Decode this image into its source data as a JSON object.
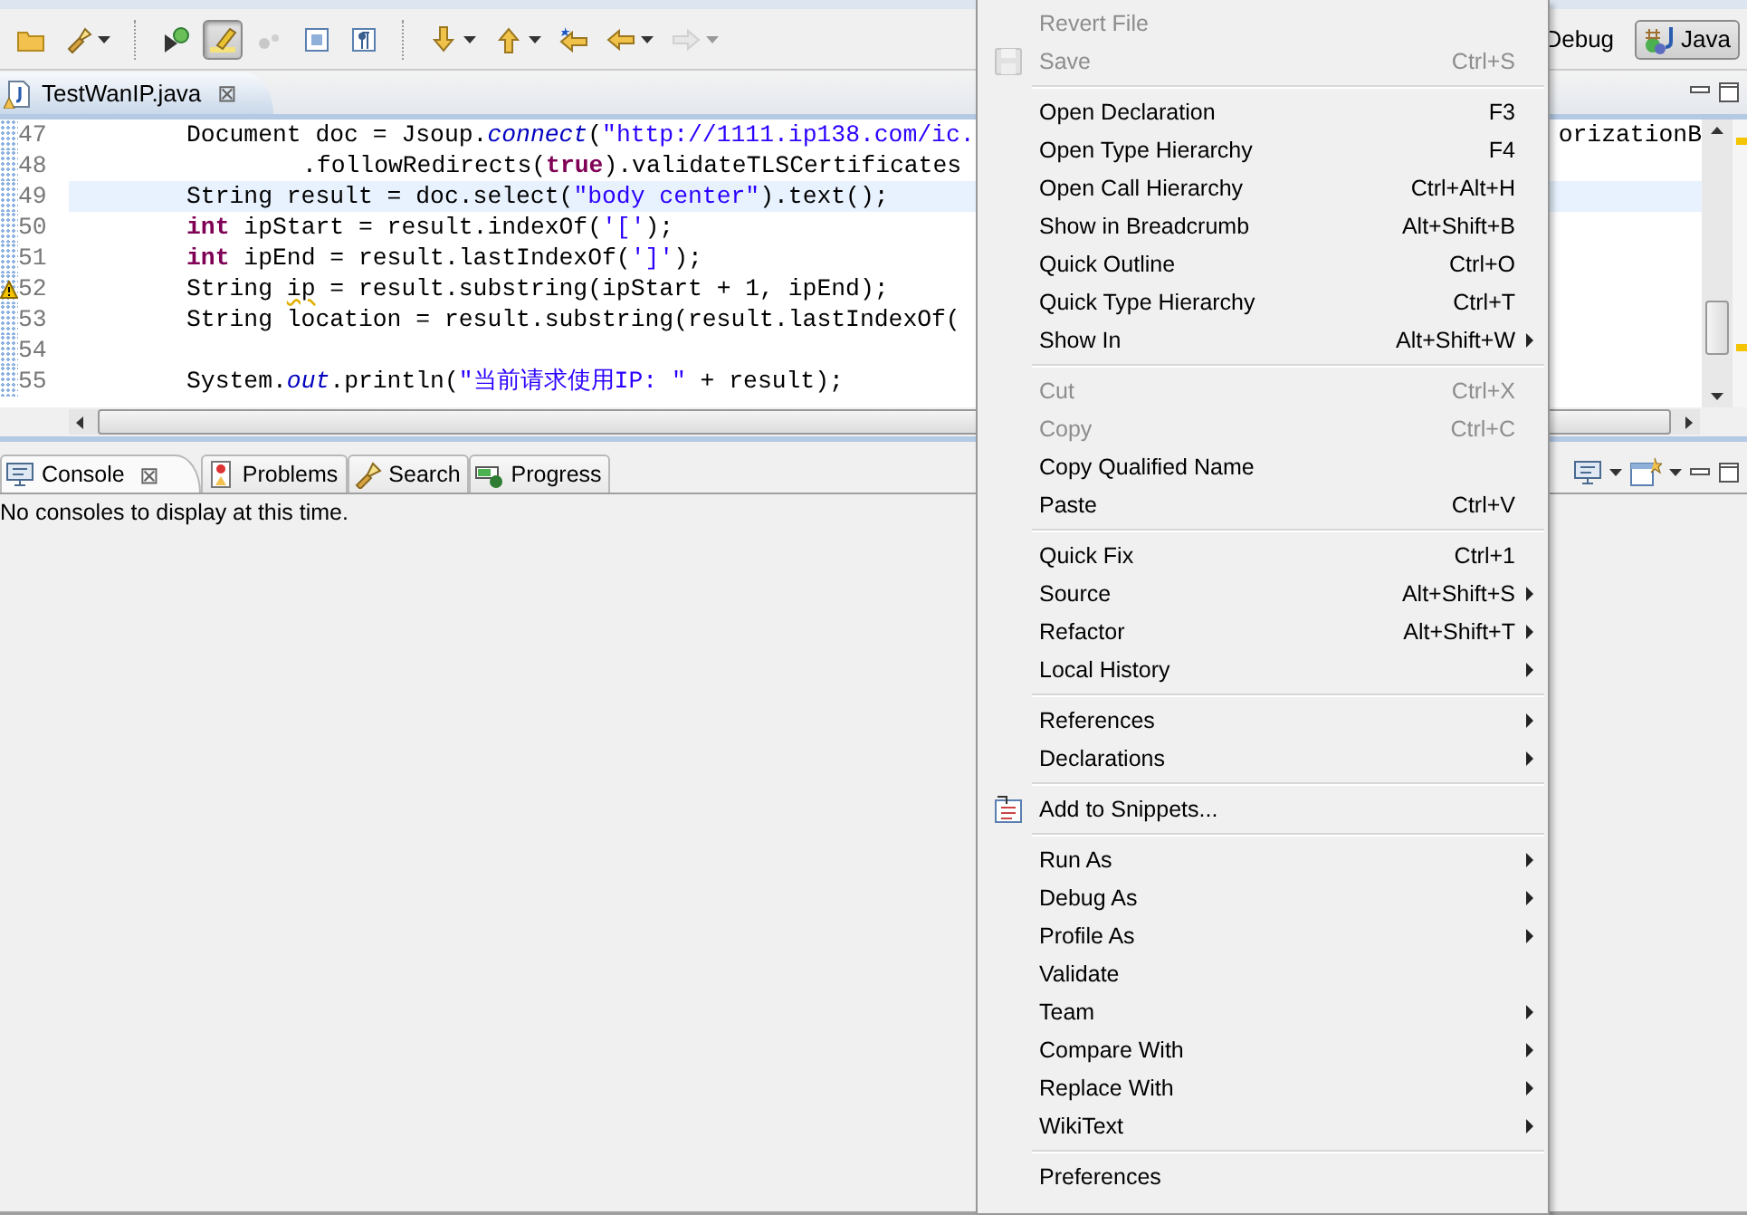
{
  "toolbar": {
    "items": [
      {
        "kind": "tool",
        "pressed": false,
        "dropdown": false,
        "disabled": false
      },
      {
        "kind": "tool",
        "pressed": false,
        "dropdown": true,
        "disabled": false
      },
      {
        "kind": "separator"
      },
      {
        "kind": "tool",
        "pressed": false,
        "dropdown": false,
        "disabled": false
      },
      {
        "kind": "tool",
        "pressed": true,
        "dropdown": false,
        "disabled": false
      },
      {
        "kind": "tool",
        "pressed": false,
        "dropdown": false,
        "disabled": true
      },
      {
        "kind": "tool",
        "pressed": false,
        "dropdown": false,
        "disabled": false
      },
      {
        "kind": "tool",
        "pressed": false,
        "dropdown": false,
        "disabled": false
      },
      {
        "kind": "separator"
      },
      {
        "kind": "tool",
        "pressed": false,
        "dropdown": true,
        "disabled": false
      },
      {
        "kind": "tool",
        "pressed": false,
        "dropdown": true,
        "disabled": false
      },
      {
        "kind": "tool",
        "pressed": false,
        "dropdown": false,
        "disabled": false
      },
      {
        "kind": "tool",
        "pressed": false,
        "dropdown": true,
        "disabled": false
      },
      {
        "kind": "tool",
        "pressed": false,
        "dropdown": true,
        "disabled": true
      }
    ],
    "perspectives": [
      {
        "label": "Debug",
        "selected": false
      },
      {
        "label": "Java",
        "selected": true
      }
    ]
  },
  "editor": {
    "tabs": [
      {
        "label": "TestWanIP.java",
        "selected": true,
        "close": "⊠"
      }
    ],
    "lines": [
      {
        "number": "47",
        "current": false,
        "warning": false,
        "continuation": false,
        "tokens": [
          {
            "kind": "plain",
            "text": "Document doc = Jsoup."
          },
          {
            "kind": "static",
            "text": "connect"
          },
          {
            "kind": "plain",
            "text": "("
          },
          {
            "kind": "string",
            "text": "\"http://1111.ip138.com/ic."
          }
        ],
        "continued": "orizationB"
      },
      {
        "number": "48",
        "current": false,
        "warning": false,
        "continuation": true,
        "tokens": [
          {
            "kind": "plain",
            "text": ".followRedirects("
          },
          {
            "kind": "keyword",
            "text": "true"
          },
          {
            "kind": "plain",
            "text": ").validateTLSCertificates"
          }
        ]
      },
      {
        "number": "49",
        "current": true,
        "warning": false,
        "continuation": false,
        "tokens": [
          {
            "kind": "plain",
            "text": "String result = doc.select("
          },
          {
            "kind": "string",
            "text": "\"body center\""
          },
          {
            "kind": "plain",
            "text": ").text();"
          }
        ]
      },
      {
        "number": "50",
        "current": false,
        "warning": false,
        "continuation": false,
        "tokens": [
          {
            "kind": "keyword",
            "text": "int"
          },
          {
            "kind": "plain",
            "text": " ipStart = result.indexOf("
          },
          {
            "kind": "string",
            "text": "'['"
          },
          {
            "kind": "plain",
            "text": ");"
          }
        ]
      },
      {
        "number": "51",
        "current": false,
        "warning": false,
        "continuation": false,
        "tokens": [
          {
            "kind": "keyword",
            "text": "int"
          },
          {
            "kind": "plain",
            "text": " ipEnd = result.lastIndexOf("
          },
          {
            "kind": "string",
            "text": "']'"
          },
          {
            "kind": "plain",
            "text": ");"
          }
        ]
      },
      {
        "number": "52",
        "current": false,
        "warning": true,
        "continuation": false,
        "tokens": [
          {
            "kind": "plain",
            "text": "String "
          },
          {
            "kind": "warning",
            "text": "ip"
          },
          {
            "kind": "plain",
            "text": " = result.substring(ipStart + 1, ipEnd);"
          }
        ]
      },
      {
        "number": "53",
        "current": false,
        "warning": false,
        "continuation": false,
        "tokens": [
          {
            "kind": "plain",
            "text": "String location = result.substring(result.lastIndexOf("
          }
        ]
      },
      {
        "number": "54",
        "current": false,
        "warning": false
      },
      {
        "number": "55",
        "current": false,
        "warning": false,
        "continuation": false,
        "tokens": [
          {
            "kind": "plain",
            "text": "System."
          },
          {
            "kind": "static",
            "text": "out"
          },
          {
            "kind": "plain",
            "text": ".println("
          },
          {
            "kind": "string",
            "text": "\"当前请求使用IP: \""
          },
          {
            "kind": "plain",
            "text": " + result);"
          }
        ]
      }
    ]
  },
  "console": {
    "tabs": [
      {
        "label": "Console",
        "selected": true,
        "close": "⊠"
      },
      {
        "label": "Problems",
        "selected": false
      },
      {
        "label": "Search",
        "selected": false
      },
      {
        "label": "Progress",
        "selected": false
      }
    ],
    "message": "No consoles to display at this time."
  },
  "menu": {
    "items": [
      {
        "kind": "item",
        "label": "Revert File",
        "disabled": true,
        "submenu": false
      },
      {
        "kind": "icon_item",
        "label": "Save",
        "shortcut": "Ctrl+S",
        "disabled": true,
        "submenu": false
      },
      {
        "kind": "separator"
      },
      {
        "kind": "item",
        "label": "Open Declaration",
        "shortcut": "F3",
        "disabled": false,
        "submenu": false
      },
      {
        "kind": "item",
        "label": "Open Type Hierarchy",
        "shortcut": "F4",
        "disabled": false,
        "submenu": false
      },
      {
        "kind": "item",
        "label": "Open Call Hierarchy",
        "shortcut": "Ctrl+Alt+H",
        "disabled": false,
        "submenu": false
      },
      {
        "kind": "item",
        "label": "Show in Breadcrumb",
        "shortcut": "Alt+Shift+B",
        "disabled": false,
        "submenu": false
      },
      {
        "kind": "item",
        "label": "Quick Outline",
        "shortcut": "Ctrl+O",
        "disabled": false,
        "submenu": false
      },
      {
        "kind": "item",
        "label": "Quick Type Hierarchy",
        "shortcut": "Ctrl+T",
        "disabled": false,
        "submenu": false
      },
      {
        "kind": "item",
        "label": "Show In",
        "shortcut": "Alt+Shift+W",
        "disabled": false,
        "submenu": true
      },
      {
        "kind": "separator"
      },
      {
        "kind": "item",
        "label": "Cut",
        "shortcut": "Ctrl+X",
        "disabled": true,
        "submenu": false
      },
      {
        "kind": "item",
        "label": "Copy",
        "shortcut": "Ctrl+C",
        "disabled": true,
        "submenu": false
      },
      {
        "kind": "item",
        "label": "Copy Qualified Name",
        "disabled": false,
        "submenu": false
      },
      {
        "kind": "item",
        "label": "Paste",
        "shortcut": "Ctrl+V",
        "disabled": false,
        "submenu": false
      },
      {
        "kind": "separator"
      },
      {
        "kind": "item",
        "label": "Quick Fix",
        "shortcut": "Ctrl+1",
        "disabled": false,
        "submenu": false
      },
      {
        "kind": "item",
        "label": "Source",
        "shortcut": "Alt+Shift+S",
        "disabled": false,
        "submenu": true
      },
      {
        "kind": "item",
        "label": "Refactor",
        "shortcut": "Alt+Shift+T",
        "disabled": false,
        "submenu": true
      },
      {
        "kind": "item",
        "label": "Local History",
        "disabled": false,
        "submenu": true
      },
      {
        "kind": "separator"
      },
      {
        "kind": "item",
        "label": "References",
        "disabled": false,
        "submenu": true
      },
      {
        "kind": "item",
        "label": "Declarations",
        "disabled": false,
        "submenu": true
      },
      {
        "kind": "separator"
      },
      {
        "kind": "icon_item",
        "label": "Add to Snippets...",
        "disabled": false,
        "submenu": false
      },
      {
        "kind": "separator"
      },
      {
        "kind": "item",
        "label": "Run As",
        "disabled": false,
        "submenu": true
      },
      {
        "kind": "item",
        "label": "Debug As",
        "disabled": false,
        "submenu": true
      },
      {
        "kind": "item",
        "label": "Profile As",
        "disabled": false,
        "submenu": true
      },
      {
        "kind": "item",
        "label": "Validate",
        "disabled": false,
        "submenu": false
      },
      {
        "kind": "item",
        "label": "Team",
        "disabled": false,
        "submenu": true
      },
      {
        "kind": "item",
        "label": "Compare With",
        "disabled": false,
        "submenu": true
      },
      {
        "kind": "item",
        "label": "Replace With",
        "disabled": false,
        "submenu": true
      },
      {
        "kind": "item",
        "label": "WikiText",
        "disabled": false,
        "submenu": true
      },
      {
        "kind": "separator"
      },
      {
        "kind": "item",
        "label": "Preferences",
        "disabled": false,
        "submenu": false
      }
    ]
  }
}
